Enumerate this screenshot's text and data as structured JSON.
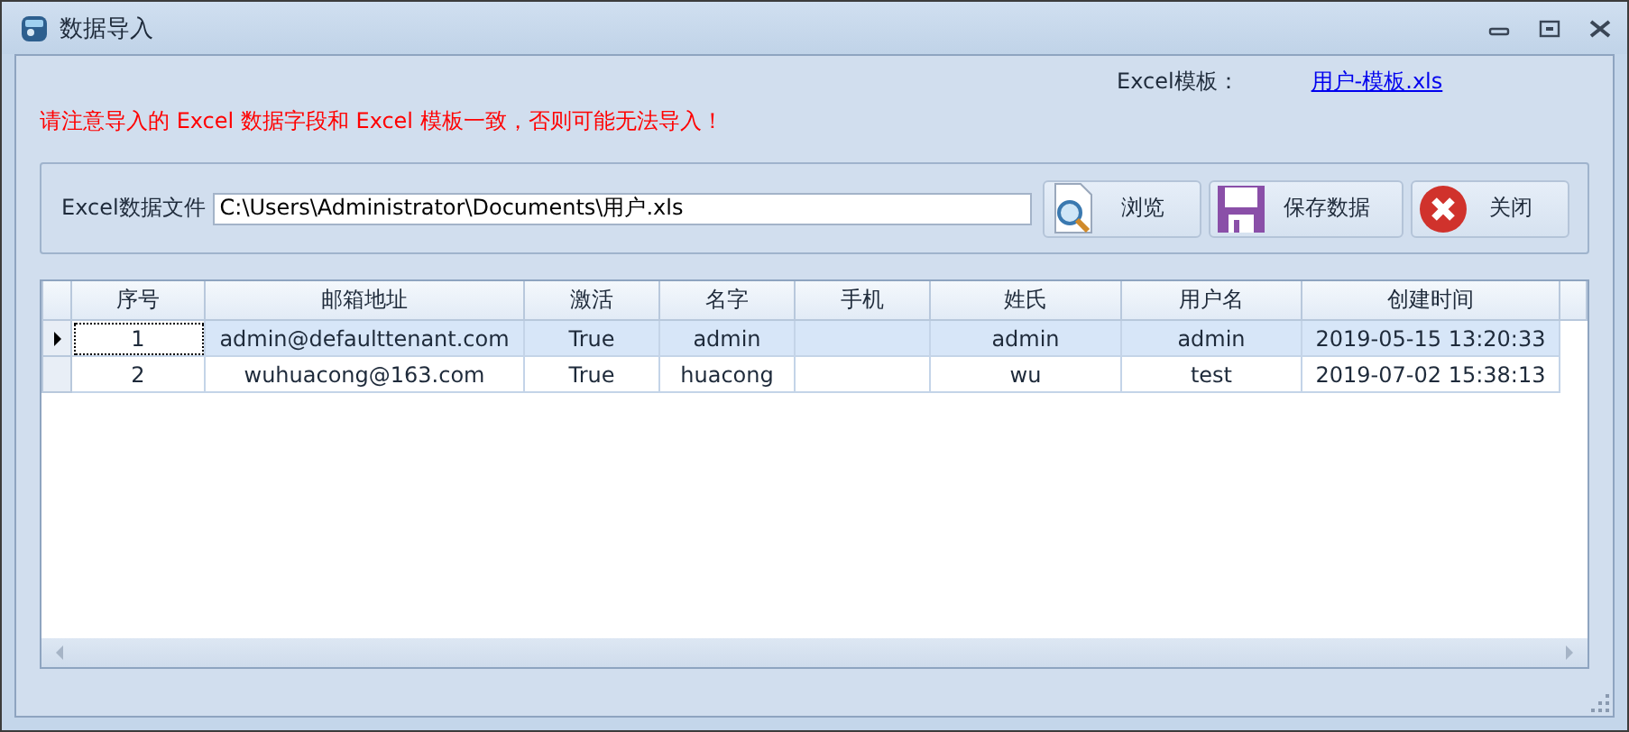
{
  "window": {
    "title": "数据导入"
  },
  "template": {
    "label": "Excel模板：",
    "link": "用户-模板.xls"
  },
  "warning": "请注意导入的 Excel 数据字段和 Excel 模板一致，否则可能无法导入！",
  "file": {
    "label": "Excel数据文件",
    "value": "C:\\Users\\Administrator\\Documents\\用户.xls"
  },
  "buttons": [
    {
      "kind": "browse",
      "label": "浏览"
    },
    {
      "kind": "save",
      "label": "保存数据"
    },
    {
      "kind": "close",
      "label": "关闭"
    }
  ],
  "table": {
    "columns": [
      "序号",
      "邮箱地址",
      "激活",
      "名字",
      "手机",
      "姓氏",
      "用户名",
      "创建时间"
    ],
    "rows": [
      {
        "selected": true,
        "cells": [
          "1",
          "admin@defaulttenant.com",
          "True",
          "admin",
          "",
          "admin",
          "admin",
          "2019-05-15 13:20:33"
        ]
      },
      {
        "selected": false,
        "cells": [
          "2",
          "wuhuacong@163.com",
          "True",
          "huacong",
          "",
          "wu",
          "test",
          "2019-07-02 15:38:13"
        ]
      }
    ]
  }
}
